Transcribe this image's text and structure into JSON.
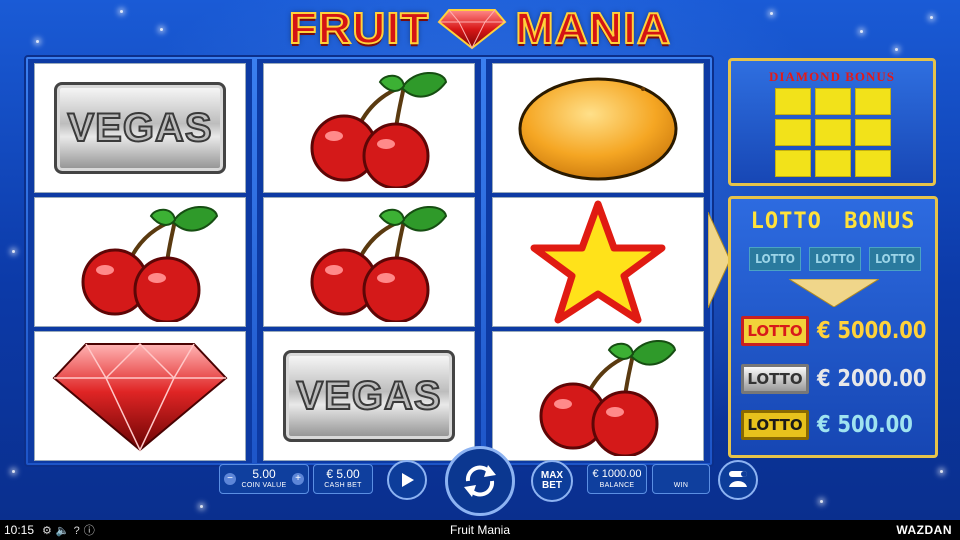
{
  "game": {
    "title_left": "FRUIT",
    "title_right": "MANIA",
    "status_time": "10:15",
    "status_title": "Fruit Mania",
    "brand": "WAZDAN"
  },
  "reels": [
    [
      "vegas",
      "cherries",
      "diamond"
    ],
    [
      "cherries",
      "cherries",
      "vegas"
    ],
    [
      "orange",
      "star",
      "cherries"
    ]
  ],
  "symbols": {
    "vegas_text": "VEGAS"
  },
  "diamond_bonus": {
    "title": "DIAMOND BONUS"
  },
  "lotto_bonus": {
    "title": "LOTTO BONUS",
    "slots": [
      "LOTTO",
      "LOTTO",
      "LOTTO"
    ],
    "prizes": [
      {
        "badge": "LOTTO",
        "amount": "€ 5000.00",
        "badge_color": "#e23b1a",
        "amount_color": "#ffd23a"
      },
      {
        "badge": "LOTTO",
        "amount": "€ 2000.00",
        "badge_color": "#c9c9c9",
        "amount_color": "#e8e8e8"
      },
      {
        "badge": "LOTTO",
        "amount": "€ 500.00",
        "badge_color": "#e8c21c",
        "amount_color": "#9fe3f0"
      }
    ]
  },
  "controls": {
    "coin_value": "5.00",
    "coin_value_label": "COIN VALUE",
    "cash_bet": "€ 5.00",
    "cash_bet_label": "CASH BET",
    "max_bet_line1": "MAX",
    "max_bet_line2": "BET",
    "balance": "€ 1000.00",
    "balance_label": "BALANCE",
    "win_label": "WIN",
    "minus": "−",
    "plus": "+"
  },
  "colors": {
    "accent_gold": "#e6c34a",
    "reel_bg": "#1d55c8"
  }
}
